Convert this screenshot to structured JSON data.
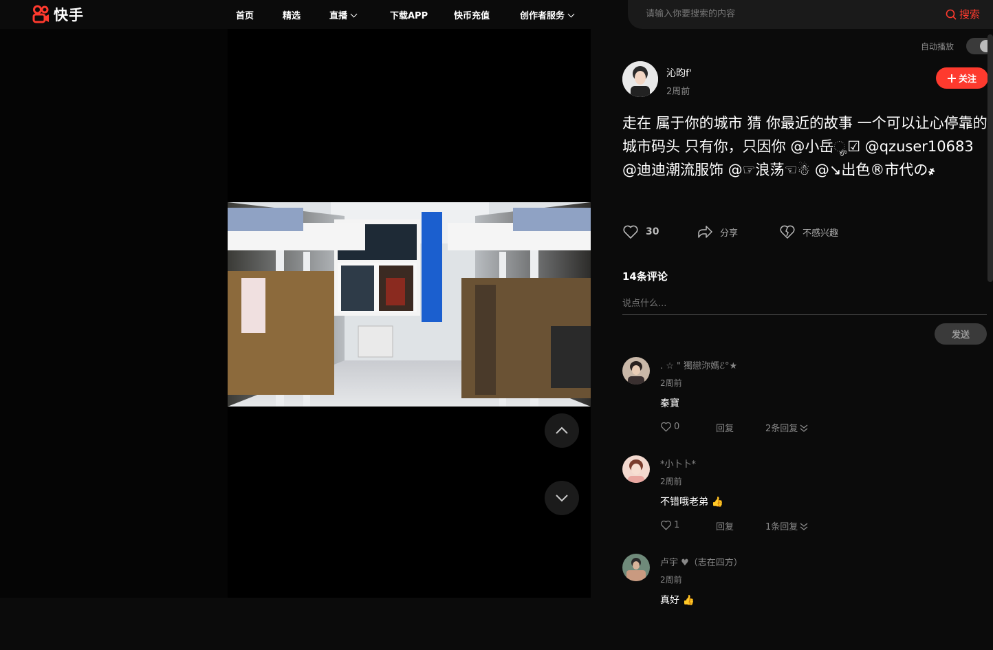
{
  "brand": {
    "name": "快手",
    "color": "#fe3a2e"
  },
  "nav": {
    "items": [
      {
        "label": "首页",
        "dropdown": false
      },
      {
        "label": "精选",
        "dropdown": false
      },
      {
        "label": "直播",
        "dropdown": true
      },
      {
        "label": "下载APP",
        "dropdown": false
      },
      {
        "label": "快币充值",
        "dropdown": false
      },
      {
        "label": "创作者服务",
        "dropdown": true
      }
    ]
  },
  "search": {
    "placeholder": "请输入你要搜索的内容",
    "button_label": "搜索"
  },
  "player": {
    "prev_icon": "chevron-up-icon",
    "next_icon": "chevron-down-icon"
  },
  "panel": {
    "autoplay_label": "自动播放",
    "autoplay_on": true,
    "author": {
      "name": "沁昀f'",
      "time": "2周前"
    },
    "follow_label": "关注",
    "caption": "走在 属于你的城市 猜 你最近的故事 一个可以让心停靠的城市码头 只有你，只因你 @小岳ೄ☑ @qzuser10683 @迪迪潮流服饰 @☞浪荡☜☃ @↘出色®市代の҂",
    "actions": {
      "like_count": "30",
      "share_label": "分享",
      "dislike_label": "不感兴趣"
    },
    "comment_count_label": "14条评论",
    "comment_placeholder": "说点什么...",
    "send_label": "发送"
  },
  "comments": [
    {
      "name": ". ☆ \" 獨戀沵媽ℰ°★",
      "time": "2周前",
      "text": "秦寶",
      "likes": "0",
      "reply_label": "回复",
      "replies_label": "2条回复"
    },
    {
      "name": "*小卜卜*",
      "time": "2周前",
      "text": "不错哦老弟 👍",
      "likes": "1",
      "reply_label": "回复",
      "replies_label": "1条回复"
    },
    {
      "name": "卢宇 ♥（志在四方）",
      "time": "2周前",
      "text": "真好 👍",
      "likes": "",
      "reply_label": "",
      "replies_label": ""
    }
  ]
}
